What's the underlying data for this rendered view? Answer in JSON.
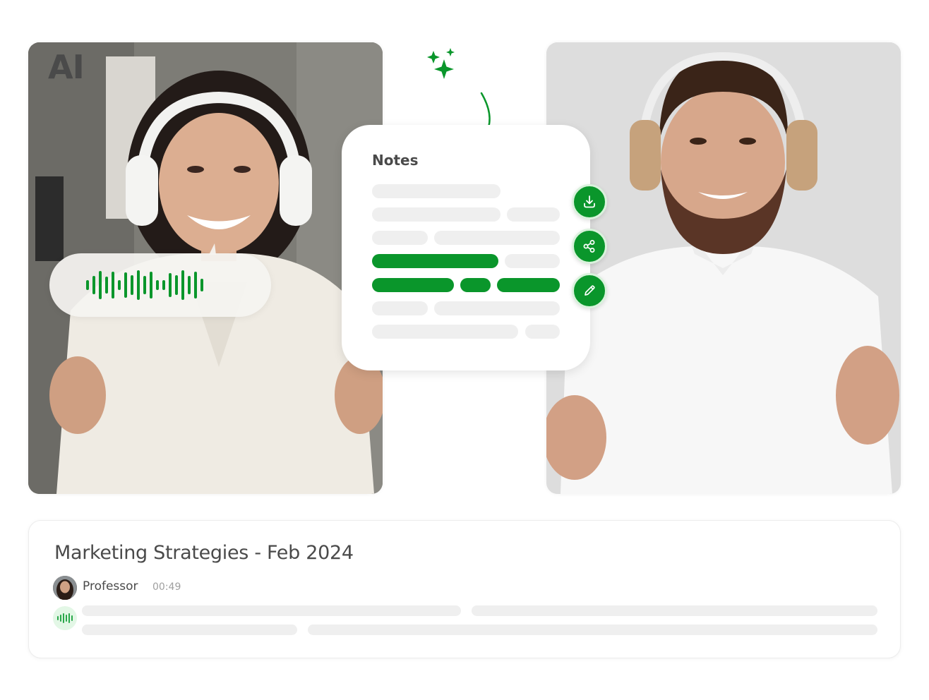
{
  "ai_badge": {
    "label": "AI",
    "icon": "sparkles-icon",
    "arrow_icon": "curved-arrow-down-icon",
    "color": "#0a962b"
  },
  "participants": [
    {
      "name": "woman-with-headphones",
      "description": "Smiling woman wearing white headphones and a cream shirt"
    },
    {
      "name": "man-with-headphones",
      "description": "Smiling bearded man wearing headphones and a white shirt"
    }
  ],
  "voice_bubble": {
    "icon": "audio-waveform-icon"
  },
  "notes_card": {
    "title": "Notes",
    "actions": [
      {
        "label": "Download",
        "icon": "download-icon"
      },
      {
        "label": "Share",
        "icon": "share-icon"
      },
      {
        "label": "Edit",
        "icon": "pencil-icon"
      }
    ]
  },
  "meeting": {
    "title": "Marketing Strategies - Feb 2024",
    "speaker": "Professor",
    "timestamp": "00:49",
    "speaker_avatar": "avatar",
    "transcript_icon": "audio-waveform-icon"
  },
  "colors": {
    "accent": "#0a962b",
    "placeholder": "#efefef",
    "text": "#4a4a4a",
    "muted": "#a0a0a0"
  }
}
